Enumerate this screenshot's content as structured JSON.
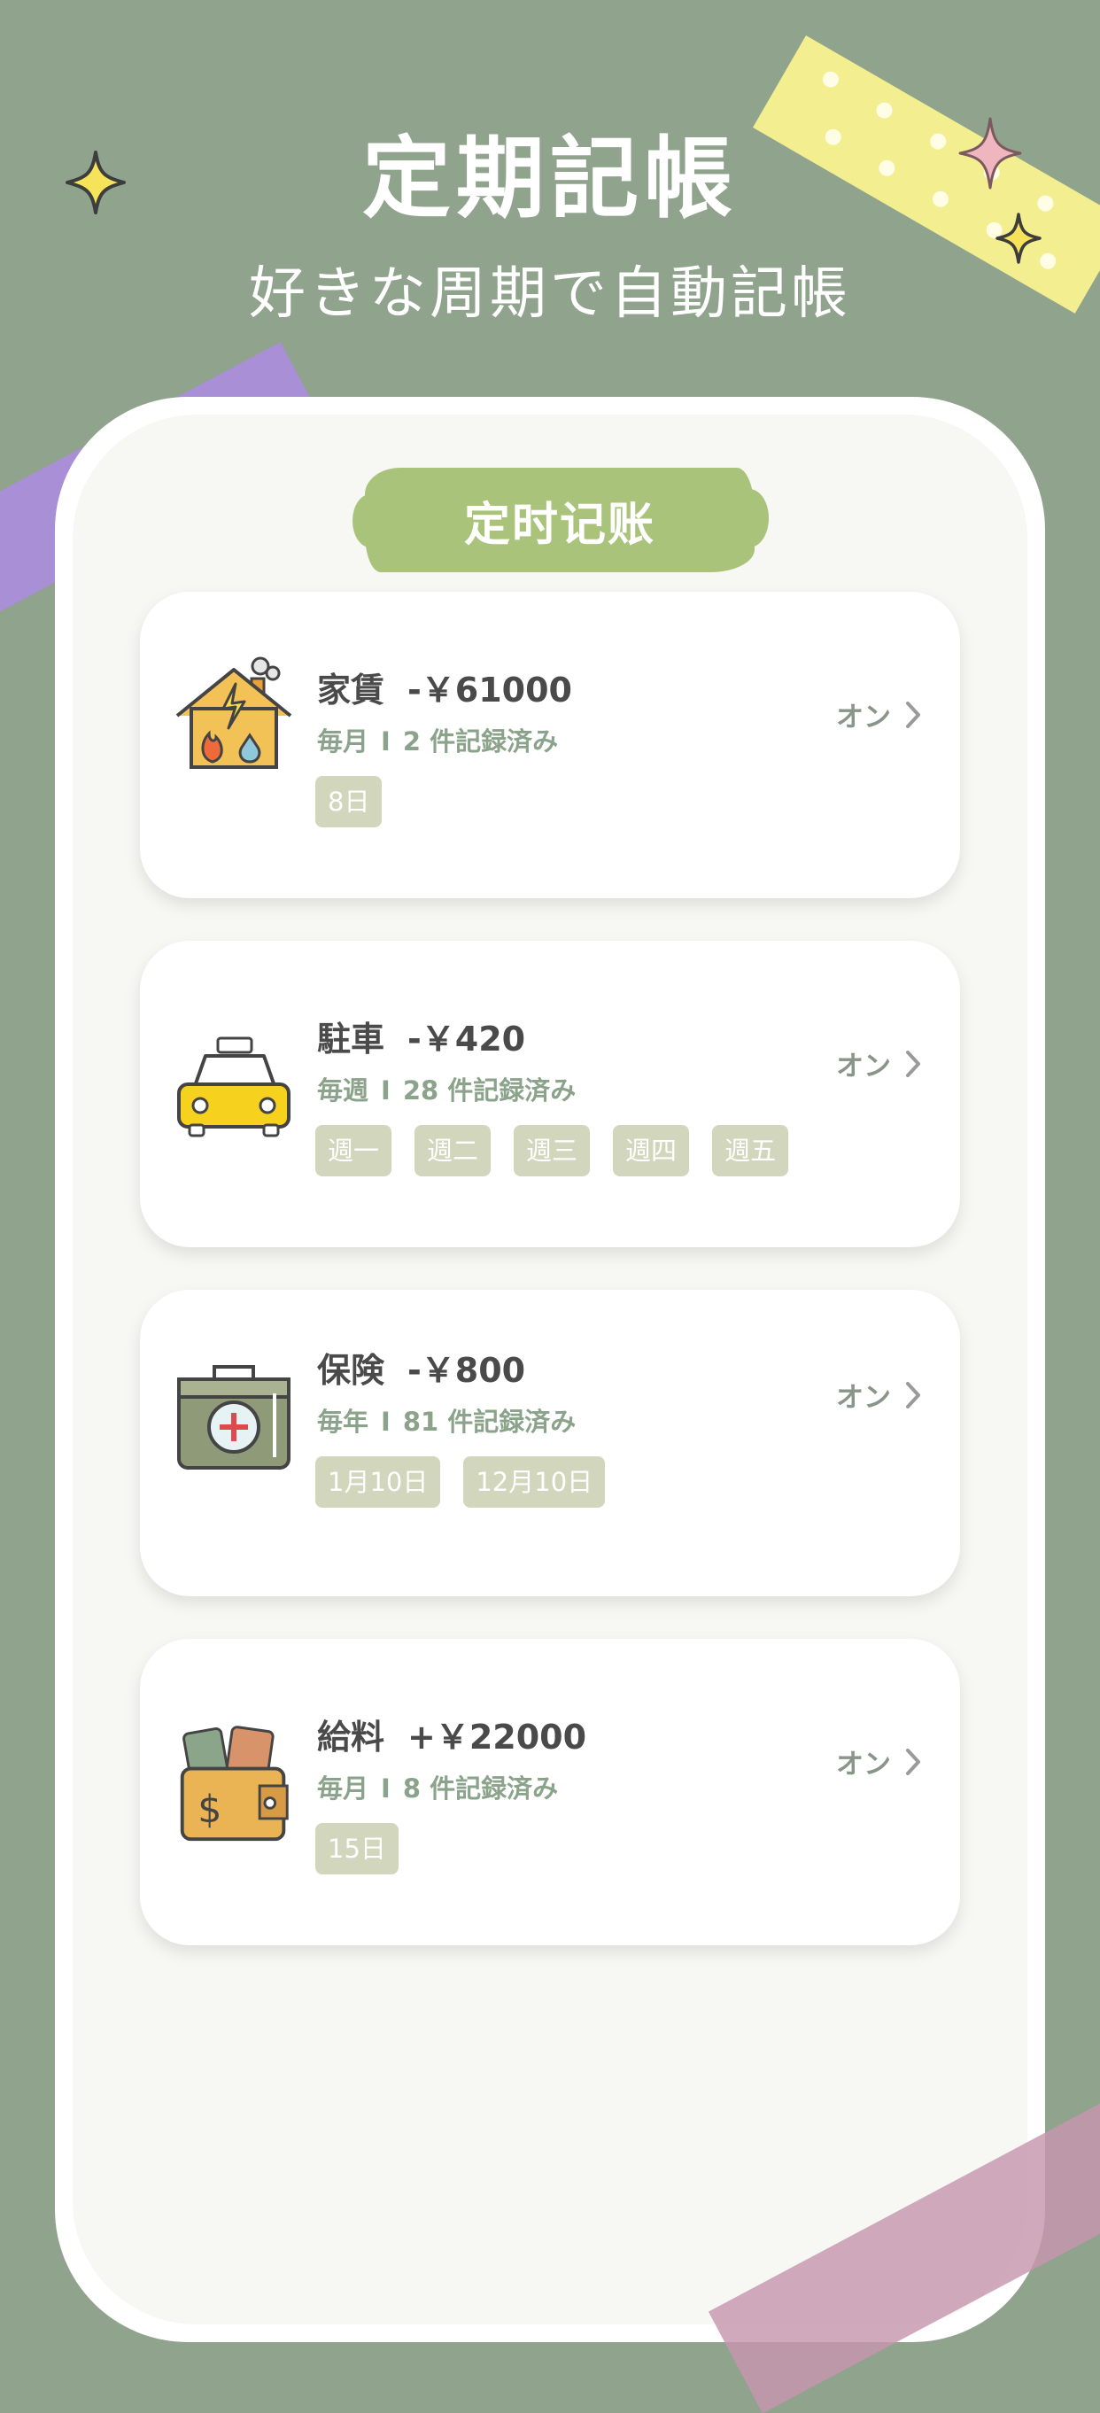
{
  "headline": "定期記帳",
  "subheadline": "好きな周期で自動記帳",
  "screen": {
    "title": "定时记账"
  },
  "entries": [
    {
      "icon": "house-utilities-icon",
      "name": "家賃",
      "amount": "-￥61000",
      "frequency": "毎月",
      "separator": "I",
      "recorded": "2 件記録済み",
      "chips": [
        "8日"
      ],
      "status": "オン"
    },
    {
      "icon": "taxi-icon",
      "name": "駐車",
      "amount": "-￥420",
      "frequency": "毎週",
      "separator": "I",
      "recorded": "28 件記録済み",
      "chips": [
        "週一",
        "週二",
        "週三",
        "週四",
        "週五"
      ],
      "status": "オン"
    },
    {
      "icon": "first-aid-kit-icon",
      "name": "保険",
      "amount": "-￥800",
      "frequency": "毎年",
      "separator": "I",
      "recorded": "81 件記録済み",
      "chips": [
        "1月10日",
        "12月10日"
      ],
      "status": "オン"
    },
    {
      "icon": "wallet-icon",
      "name": "給料",
      "amount": "+￥22000",
      "frequency": "毎月",
      "separator": "I",
      "recorded": "8 件記録済み",
      "chips": [
        "15日"
      ],
      "status": "オン"
    }
  ]
}
